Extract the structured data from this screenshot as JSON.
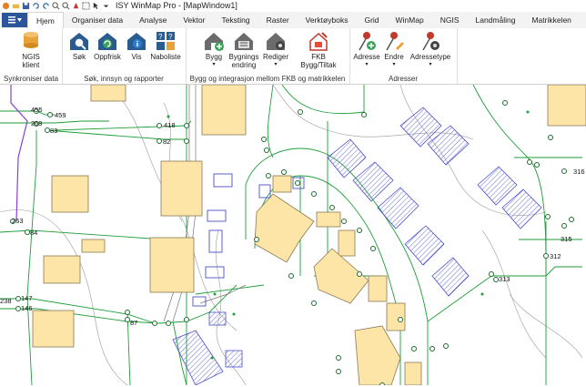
{
  "window": {
    "title": "ISY WinMap Pro - [MapWindow1]"
  },
  "tabs": [
    "Hjem",
    "Organiser data",
    "Analyse",
    "Vektor",
    "Teksting",
    "Raster",
    "Verktøyboks",
    "Grid",
    "WinMap",
    "NGIS",
    "Landmåling",
    "Matrikkelen"
  ],
  "ribbon": {
    "groups": {
      "sync": {
        "label": "Synkroniser data",
        "ngis_label": "NGIS\nklient"
      },
      "search": {
        "label": "Søk, innsyn og rapporter",
        "sok": "Søk",
        "oppfrisk": "Oppfrisk",
        "vis": "Vis",
        "naboliste": "Naboliste"
      },
      "build": {
        "label": "Bygg og integrasjon mellom FKB og matrikkelen",
        "bygg": "Bygg",
        "bygningsendring": "Bygnings\nendring",
        "rediger": "Rediger",
        "fkb": "FKB\nBygg/Tiltak"
      },
      "addr": {
        "label": "Adresser",
        "adresse": "Adresse",
        "endre": "Endre",
        "adressetype": "Adressetype"
      }
    }
  },
  "map": {
    "labels": [
      {
        "text": "455"
      },
      {
        "text": "459"
      },
      {
        "text": "269"
      },
      {
        "text": "83"
      },
      {
        "text": "418"
      },
      {
        "text": "82"
      },
      {
        "text": "263"
      },
      {
        "text": "84"
      },
      {
        "text": "238"
      },
      {
        "text": "147"
      },
      {
        "text": "146"
      },
      {
        "text": "87"
      },
      {
        "text": "316"
      },
      {
        "text": "315"
      },
      {
        "text": "312"
      },
      {
        "text": "313"
      }
    ]
  },
  "colors": {
    "accent": "#2b579a",
    "building_fill": "#fde5a8",
    "building_stroke": "#8a7a55",
    "line_green": "#1f9e3a",
    "hatch_blue": "#6a6fd6",
    "purple_line": "#8a3fd1"
  }
}
